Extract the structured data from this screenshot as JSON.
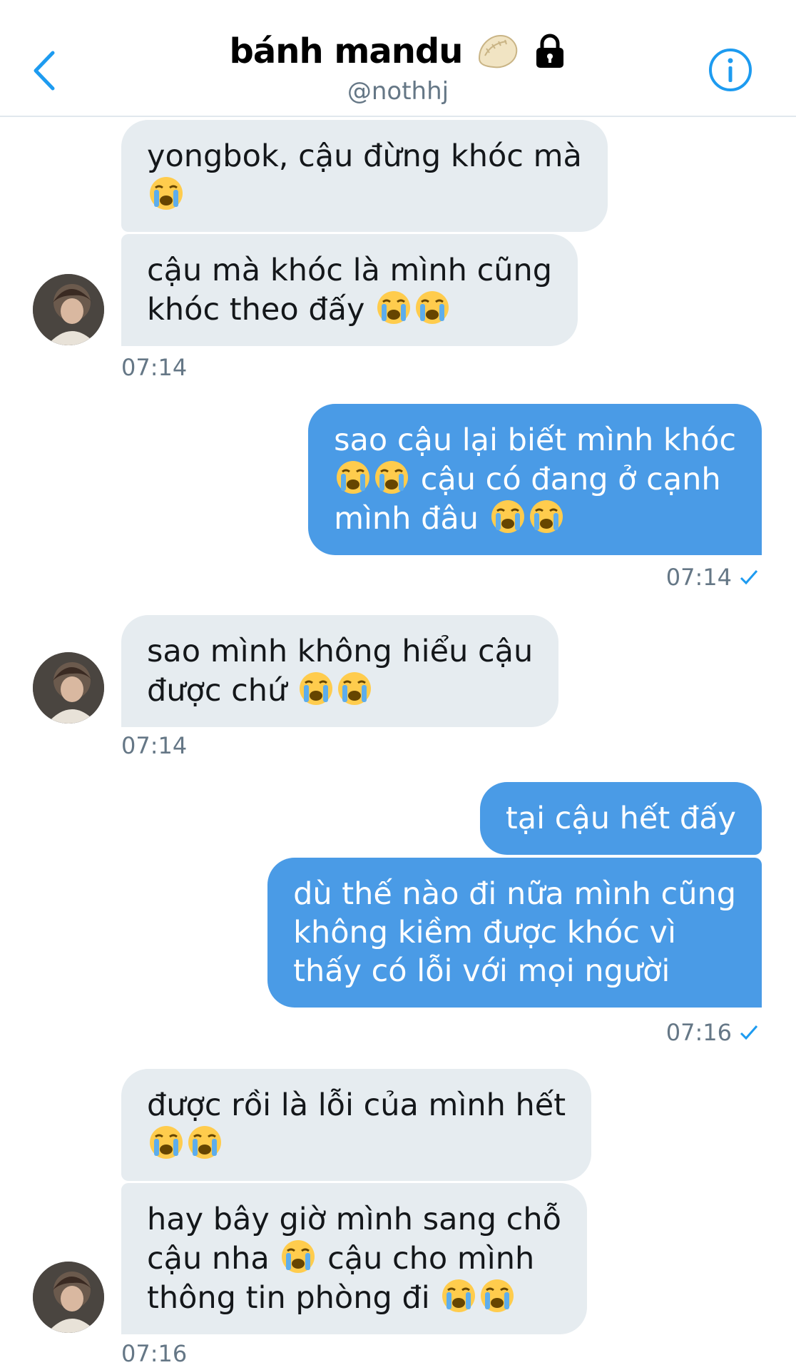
{
  "header": {
    "title": "bánh mandu",
    "handle": "@nothhj",
    "title_emoji": "dumpling-emoji",
    "lock_icon": "lock-icon",
    "back_icon": "chevron-left-icon",
    "info_icon": "info-icon"
  },
  "colors": {
    "accent": "#1d9bf0",
    "outgoing_bubble": "#4a9be6",
    "incoming_bubble": "#e6ecf0",
    "muted_text": "#657786"
  },
  "messages": [
    {
      "dir": "in",
      "lines": [
        "yongbok, cậu đừng khóc mà"
      ],
      "tail_emojis": 1
    },
    {
      "dir": "in",
      "lines": [
        "cậu mà khóc là mình cũng",
        "khóc theo đấy"
      ],
      "tail_emojis": 2
    },
    {
      "time": "07:14"
    },
    {
      "dir": "out",
      "lines": [
        "sao cậu lại biết mình khóc",
        "cậu có đang ở cạnh",
        "mình đâu"
      ]
    },
    {
      "time": "07:14"
    },
    {
      "dir": "in",
      "lines": [
        "sao mình không hiểu cậu",
        "được chứ"
      ]
    },
    {
      "time": "07:14"
    },
    {
      "dir": "out",
      "lines": [
        "tại cậu hết đấy"
      ]
    },
    {
      "dir": "out",
      "lines": [
        "dù thế nào đi nữa mình cũng",
        "không kiềm được khóc vì",
        "thấy có lỗi với mọi người"
      ]
    },
    {
      "time": "07:16"
    },
    {
      "dir": "in",
      "lines": [
        "được rồi là lỗi của mình hết"
      ]
    },
    {
      "dir": "in",
      "lines": [
        "hay bây giờ mình sang chỗ",
        "cậu nha",
        "cậu cho mình",
        "thông tin phòng đi"
      ]
    },
    {
      "time": "07:16"
    }
  ]
}
